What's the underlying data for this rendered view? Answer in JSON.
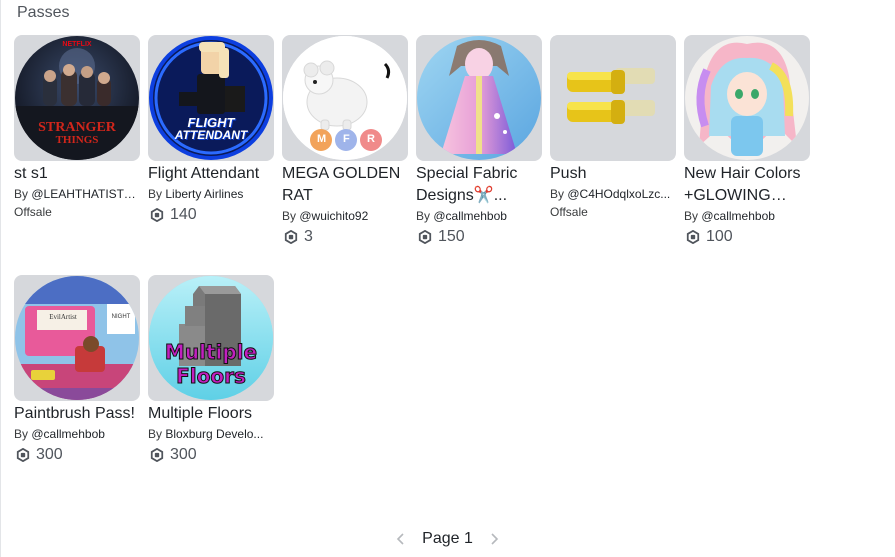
{
  "section": {
    "title": "Passes"
  },
  "passes": [
    {
      "name": "st s1",
      "by": "By",
      "creator": "@LEAHTHATISTO...",
      "status": "Offsale",
      "price": null
    },
    {
      "name": "Flight Attendant",
      "by": "By",
      "creator": "Liberty Airlines",
      "status": null,
      "price": "140"
    },
    {
      "name": "MEGA GOLDEN RAT",
      "by": "By",
      "creator": "@wuichito92",
      "status": null,
      "price": "3"
    },
    {
      "name": "Special Fabric Designs✂️...",
      "by": "By",
      "creator": "@callmehbob",
      "status": null,
      "price": "150"
    },
    {
      "name": "Push",
      "by": "By",
      "creator": "@C4HOdqlxoLzc...",
      "status": "Offsale",
      "price": null
    },
    {
      "name": "New Hair Colors +GLOWING Hai...",
      "by": "By",
      "creator": "@callmehbob",
      "status": null,
      "price": "100"
    },
    {
      "name": "Paintbrush Pass!",
      "by": "By",
      "creator": "@callmehbob",
      "status": null,
      "price": "300"
    },
    {
      "name": "Multiple Floors",
      "by": "By",
      "creator": "Bloxburg Develo...",
      "status": null,
      "price": "300"
    }
  ],
  "thumb_text": {
    "netflix": "NETFLIX",
    "stranger": "STRANGER",
    "things": "THINGS",
    "flight": "FLIGHT",
    "attendant": "ATTENDANT",
    "mfr": [
      "M",
      "F",
      "R"
    ],
    "evil_artist": "EvilArtist",
    "night": "NIGHT",
    "multiple": "Multiple",
    "floors": "Floors"
  },
  "pagination": {
    "label": "Page 1"
  },
  "colors": {
    "accent": "#1f2328",
    "muted": "#50555c",
    "thumb_bg": "#d6d8dc"
  },
  "icons": {
    "robux": "robux-icon",
    "prev": "chevron-left-icon",
    "next": "chevron-right-icon"
  }
}
